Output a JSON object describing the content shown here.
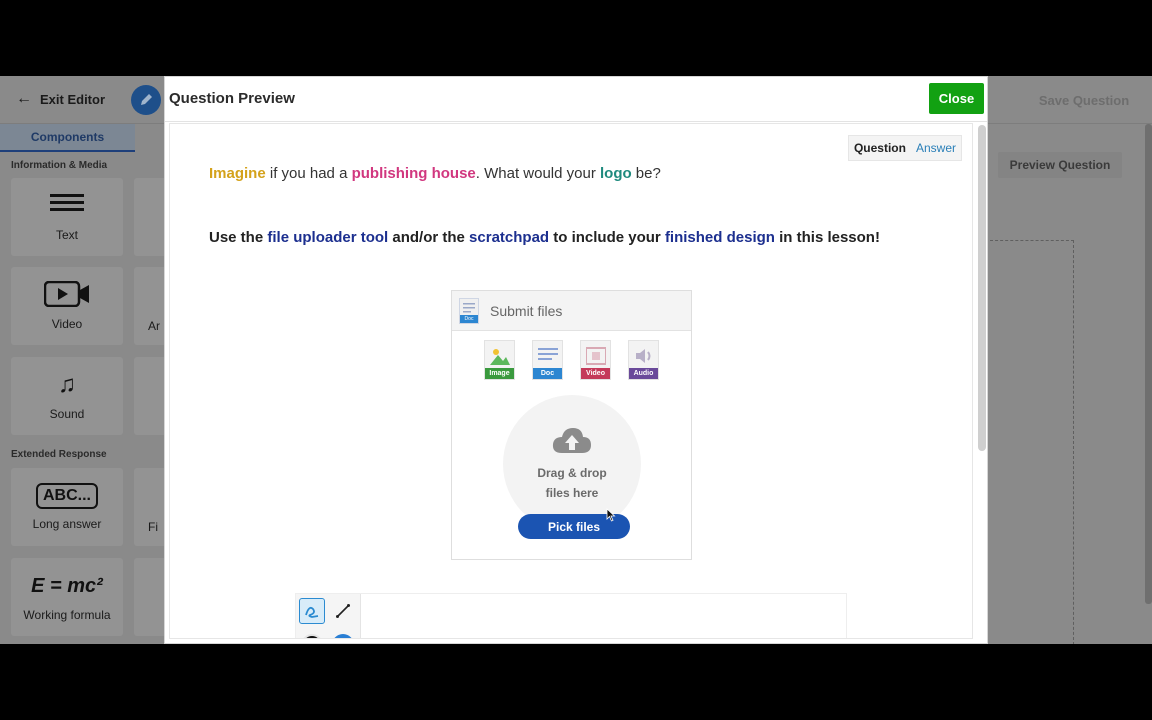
{
  "editor": {
    "exit_label": "Exit Editor",
    "save_label": "Save Question",
    "preview_label": "Preview Question"
  },
  "sidebar": {
    "tab": "Components",
    "sections": [
      {
        "label": "Information & Media"
      },
      {
        "label": "Extended Response"
      }
    ],
    "tiles": [
      {
        "label": "Text",
        "icon": "text-lines-icon"
      },
      {
        "label": "Video",
        "icon": "video-camera-icon"
      },
      {
        "label": "Sound",
        "icon": "music-note-icon"
      },
      {
        "label": "Long answer",
        "icon": "abc-box-icon",
        "glyph": "ABC..."
      },
      {
        "label": "Working formula",
        "icon": "formula-icon",
        "glyph": "E = mc²"
      }
    ],
    "stubs": [
      "Ar",
      "Fi"
    ]
  },
  "modal": {
    "title": "Question Preview",
    "close_label": "Close",
    "toggle": {
      "question": "Question",
      "answer": "Answer"
    },
    "line1": [
      {
        "text": "Imagine",
        "style": "yellow"
      },
      {
        "text": " if you had a ",
        "style": "plain"
      },
      {
        "text": "publishing house",
        "style": "pink"
      },
      {
        "text": ". What would your ",
        "style": "plain"
      },
      {
        "text": "logo",
        "style": "teal"
      },
      {
        "text": " be?",
        "style": "plain"
      }
    ],
    "line2": [
      {
        "text": "Use the ",
        "style": "plain"
      },
      {
        "text": "file uploader tool",
        "style": "navy"
      },
      {
        "text": " and/or the ",
        "style": "plain"
      },
      {
        "text": "scratchpad",
        "style": "navy"
      },
      {
        "text": " to include your ",
        "style": "plain"
      },
      {
        "text": "finished design",
        "style": "navy"
      },
      {
        "text": " in this lesson!",
        "style": "plain"
      }
    ]
  },
  "uploader": {
    "title": "Submit files",
    "head_tag": "Doc",
    "types": [
      {
        "label": "Image",
        "color": "#3a9a3e",
        "icon": "image-file-icon"
      },
      {
        "label": "Doc",
        "color": "#2c86d1",
        "icon": "doc-file-icon"
      },
      {
        "label": "Video",
        "color": "#c43a5a",
        "icon": "video-file-icon"
      },
      {
        "label": "Audio",
        "color": "#6a4a9a",
        "icon": "audio-file-icon"
      }
    ],
    "drop_line1": "Drag & drop",
    "drop_line2": "files here",
    "pick_label": "Pick files"
  },
  "colors": {
    "close": "#12a112",
    "pick": "#1b54b2",
    "accent_yellow": "#d4a21b",
    "accent_pink": "#d1377f",
    "accent_teal": "#1f8a7e",
    "accent_navy": "#1c2f8f"
  }
}
